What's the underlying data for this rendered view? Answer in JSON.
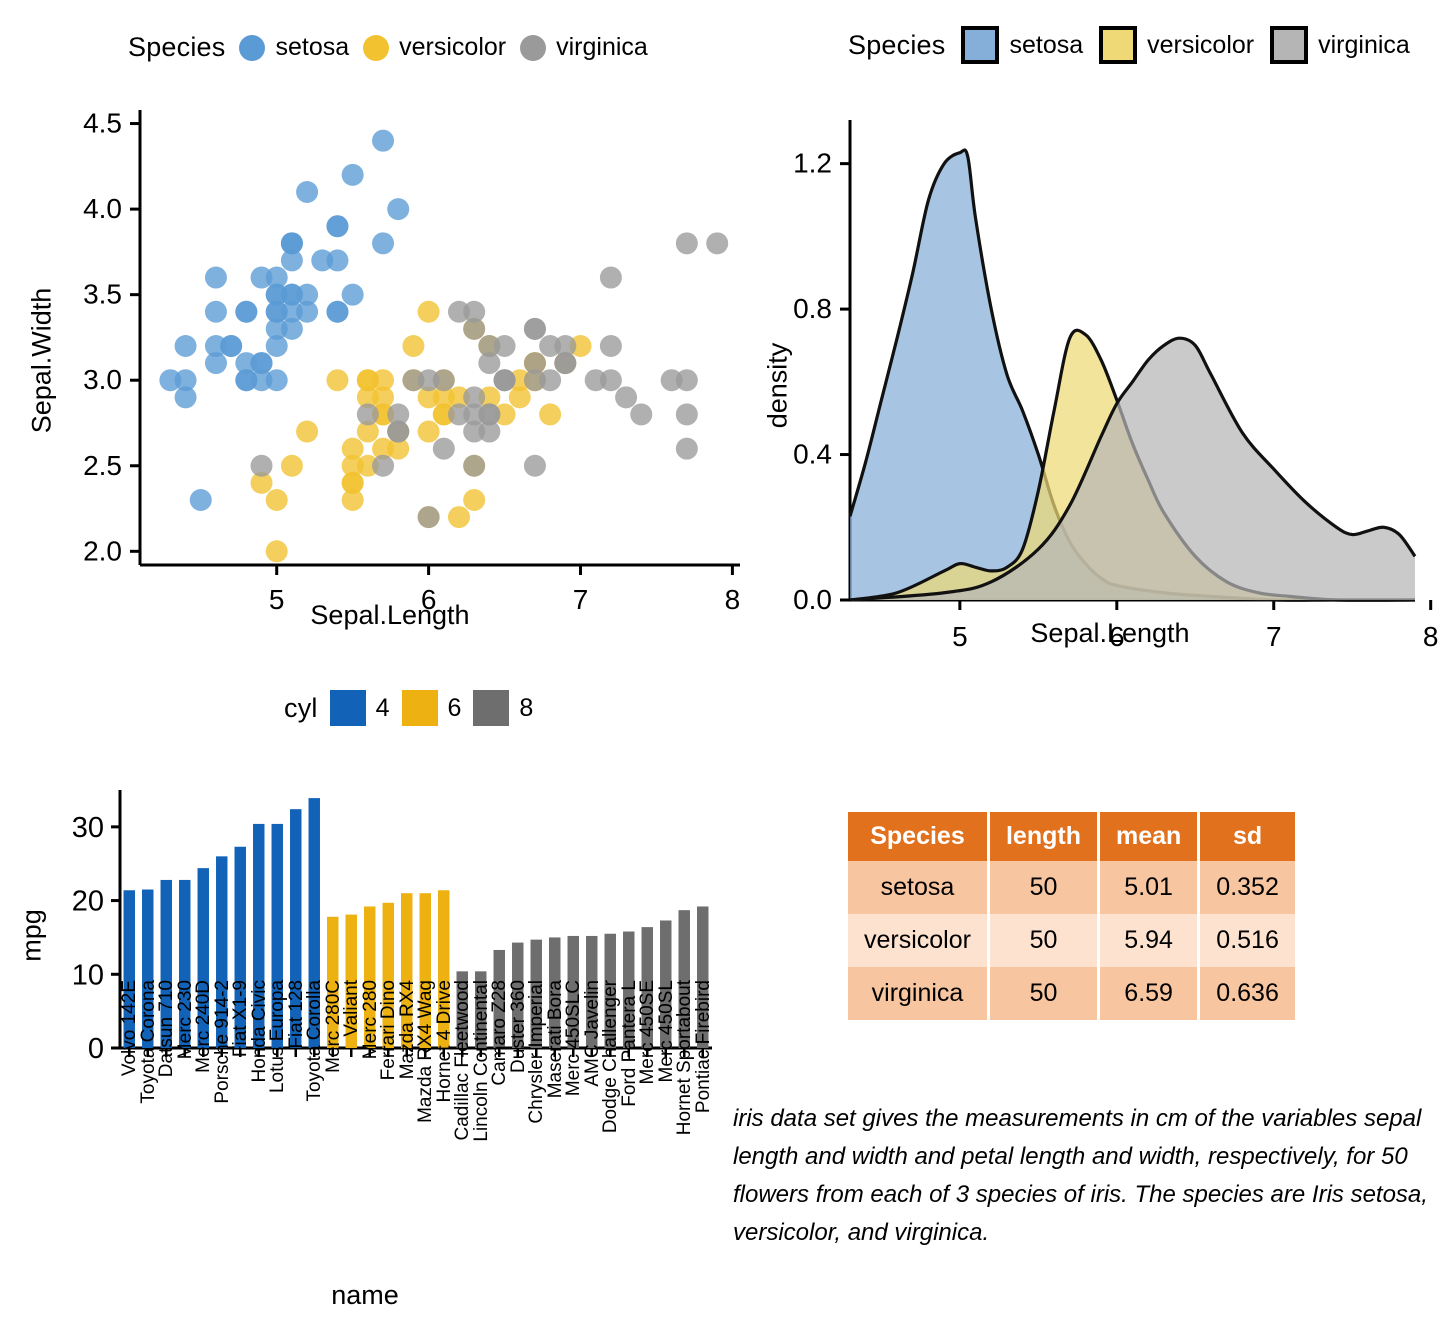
{
  "legends": {
    "species_points": {
      "title": "Species",
      "items": [
        {
          "label": "setosa",
          "color": "#5B9BD5",
          "marker": "circle"
        },
        {
          "label": "versicolor",
          "color": "#F2C230",
          "marker": "circle"
        },
        {
          "label": "virginica",
          "color": "#9A9A9A",
          "marker": "circle"
        }
      ]
    },
    "species_fill": {
      "title": "Species",
      "items": [
        {
          "label": "setosa",
          "color": "#85AFD8"
        },
        {
          "label": "versicolor",
          "color": "#EED976"
        },
        {
          "label": "virginica",
          "color": "#B5B5B5"
        }
      ]
    },
    "cyl": {
      "title": "cyl",
      "items": [
        {
          "label": "4",
          "color": "#1263B8"
        },
        {
          "label": "6",
          "color": "#EDB211"
        },
        {
          "label": "8",
          "color": "#6E6E6E"
        }
      ]
    }
  },
  "chart_data": [
    {
      "type": "scatter",
      "id": "iris-scatter",
      "title": "",
      "xlabel": "Sepal.Length",
      "ylabel": "Sepal.Width",
      "xlim": [
        4.1,
        8.05
      ],
      "ylim": [
        1.92,
        4.55
      ],
      "xticks": [
        5,
        6,
        7,
        8
      ],
      "yticks": [
        "2.0",
        "2.5",
        "3.0",
        "3.5",
        "4.0",
        "4.5"
      ],
      "grid": false,
      "legend_position": "top",
      "series": [
        {
          "name": "setosa",
          "color": "#5B9BD5",
          "points": [
            [
              5.1,
              3.5
            ],
            [
              4.9,
              3.0
            ],
            [
              4.7,
              3.2
            ],
            [
              4.6,
              3.1
            ],
            [
              5.0,
              3.6
            ],
            [
              5.4,
              3.9
            ],
            [
              4.6,
              3.4
            ],
            [
              5.0,
              3.4
            ],
            [
              4.4,
              2.9
            ],
            [
              4.9,
              3.1
            ],
            [
              5.4,
              3.7
            ],
            [
              4.8,
              3.4
            ],
            [
              4.8,
              3.0
            ],
            [
              4.3,
              3.0
            ],
            [
              5.8,
              4.0
            ],
            [
              5.7,
              4.4
            ],
            [
              5.4,
              3.9
            ],
            [
              5.1,
              3.5
            ],
            [
              5.7,
              3.8
            ],
            [
              5.1,
              3.8
            ],
            [
              5.4,
              3.4
            ],
            [
              5.1,
              3.7
            ],
            [
              4.6,
              3.6
            ],
            [
              5.1,
              3.3
            ],
            [
              4.8,
              3.4
            ],
            [
              5.0,
              3.0
            ],
            [
              5.0,
              3.4
            ],
            [
              5.2,
              3.5
            ],
            [
              5.2,
              3.4
            ],
            [
              4.7,
              3.2
            ],
            [
              4.8,
              3.1
            ],
            [
              5.4,
              3.4
            ],
            [
              5.2,
              4.1
            ],
            [
              5.5,
              4.2
            ],
            [
              4.9,
              3.1
            ],
            [
              5.0,
              3.2
            ],
            [
              5.5,
              3.5
            ],
            [
              4.9,
              3.6
            ],
            [
              4.4,
              3.0
            ],
            [
              5.1,
              3.4
            ],
            [
              5.0,
              3.5
            ],
            [
              4.5,
              2.3
            ],
            [
              4.4,
              3.2
            ],
            [
              5.0,
              3.5
            ],
            [
              5.1,
              3.8
            ],
            [
              4.8,
              3.0
            ],
            [
              5.1,
              3.8
            ],
            [
              4.6,
              3.2
            ],
            [
              5.3,
              3.7
            ],
            [
              5.0,
              3.3
            ]
          ]
        },
        {
          "name": "versicolor",
          "color": "#F2C230",
          "points": [
            [
              7.0,
              3.2
            ],
            [
              6.4,
              3.2
            ],
            [
              6.9,
              3.1
            ],
            [
              5.5,
              2.3
            ],
            [
              6.5,
              2.8
            ],
            [
              5.7,
              2.8
            ],
            [
              6.3,
              3.3
            ],
            [
              4.9,
              2.4
            ],
            [
              6.6,
              2.9
            ],
            [
              5.2,
              2.7
            ],
            [
              5.0,
              2.0
            ],
            [
              5.9,
              3.0
            ],
            [
              6.0,
              2.2
            ],
            [
              6.1,
              2.9
            ],
            [
              5.6,
              2.9
            ],
            [
              6.7,
              3.1
            ],
            [
              5.6,
              3.0
            ],
            [
              5.8,
              2.7
            ],
            [
              6.2,
              2.2
            ],
            [
              5.6,
              2.5
            ],
            [
              5.9,
              3.2
            ],
            [
              6.1,
              2.8
            ],
            [
              6.3,
              2.5
            ],
            [
              6.1,
              2.8
            ],
            [
              6.4,
              2.9
            ],
            [
              6.6,
              3.0
            ],
            [
              6.8,
              2.8
            ],
            [
              6.7,
              3.0
            ],
            [
              6.0,
              2.9
            ],
            [
              5.7,
              2.6
            ],
            [
              5.5,
              2.4
            ],
            [
              5.5,
              2.4
            ],
            [
              5.8,
              2.7
            ],
            [
              6.0,
              2.7
            ],
            [
              5.4,
              3.0
            ],
            [
              6.0,
              3.4
            ],
            [
              6.7,
              3.1
            ],
            [
              6.3,
              2.3
            ],
            [
              5.6,
              3.0
            ],
            [
              5.5,
              2.5
            ],
            [
              5.5,
              2.6
            ],
            [
              6.1,
              3.0
            ],
            [
              5.8,
              2.6
            ],
            [
              5.0,
              2.3
            ],
            [
              5.6,
              2.7
            ],
            [
              5.7,
              3.0
            ],
            [
              5.7,
              2.9
            ],
            [
              6.2,
              2.9
            ],
            [
              5.1,
              2.5
            ],
            [
              5.7,
              2.8
            ]
          ]
        },
        {
          "name": "virginica",
          "color": "#9A9A9A",
          "points": [
            [
              6.3,
              3.3
            ],
            [
              5.8,
              2.7
            ],
            [
              7.1,
              3.0
            ],
            [
              6.3,
              2.9
            ],
            [
              6.5,
              3.0
            ],
            [
              7.6,
              3.0
            ],
            [
              4.9,
              2.5
            ],
            [
              7.3,
              2.9
            ],
            [
              6.7,
              2.5
            ],
            [
              7.2,
              3.6
            ],
            [
              6.5,
              3.2
            ],
            [
              6.4,
              2.7
            ],
            [
              6.8,
              3.0
            ],
            [
              5.7,
              2.5
            ],
            [
              5.8,
              2.8
            ],
            [
              6.4,
              3.2
            ],
            [
              6.5,
              3.0
            ],
            [
              7.7,
              3.8
            ],
            [
              7.7,
              2.6
            ],
            [
              6.0,
              2.2
            ],
            [
              6.9,
              3.2
            ],
            [
              5.6,
              2.8
            ],
            [
              7.7,
              2.8
            ],
            [
              6.3,
              2.7
            ],
            [
              6.7,
              3.3
            ],
            [
              7.2,
              3.2
            ],
            [
              6.2,
              2.8
            ],
            [
              6.1,
              3.0
            ],
            [
              6.4,
              2.8
            ],
            [
              7.2,
              3.0
            ],
            [
              7.4,
              2.8
            ],
            [
              7.9,
              3.8
            ],
            [
              6.4,
              2.8
            ],
            [
              6.3,
              2.8
            ],
            [
              6.1,
              2.6
            ],
            [
              7.7,
              3.0
            ],
            [
              6.3,
              3.4
            ],
            [
              6.4,
              3.1
            ],
            [
              6.0,
              3.0
            ],
            [
              6.9,
              3.1
            ],
            [
              6.7,
              3.1
            ],
            [
              6.9,
              3.1
            ],
            [
              5.8,
              2.7
            ],
            [
              6.8,
              3.2
            ],
            [
              6.7,
              3.3
            ],
            [
              6.7,
              3.0
            ],
            [
              6.3,
              2.5
            ],
            [
              6.5,
              3.0
            ],
            [
              6.2,
              3.4
            ],
            [
              5.9,
              3.0
            ]
          ]
        }
      ]
    },
    {
      "type": "area",
      "id": "iris-density",
      "title": "",
      "xlabel": "Sepal.Length",
      "ylabel": "density",
      "xlim": [
        4.3,
        7.9
      ],
      "ylim": [
        0.0,
        1.32
      ],
      "xticks": [
        5,
        6,
        7,
        8
      ],
      "yticks": [
        "0.0",
        "0.4",
        "0.8",
        "1.2"
      ],
      "grid": false,
      "legend_position": "top",
      "series": [
        {
          "name": "setosa",
          "color": "#85AFD8",
          "x": [
            4.3,
            4.4,
            4.5,
            4.6,
            4.7,
            4.8,
            4.9,
            5.0,
            5.05,
            5.1,
            5.2,
            5.3,
            5.4,
            5.5,
            5.6,
            5.7,
            5.8,
            5.9,
            6.0,
            6.3,
            6.6,
            7.0,
            7.4,
            7.9
          ],
          "y": [
            0.23,
            0.38,
            0.55,
            0.72,
            0.9,
            1.1,
            1.2,
            1.23,
            1.22,
            1.05,
            0.8,
            0.62,
            0.52,
            0.4,
            0.26,
            0.16,
            0.1,
            0.06,
            0.04,
            0.02,
            0.01,
            0.0,
            0.0,
            0.0
          ]
        },
        {
          "name": "versicolor",
          "color": "#EED976",
          "x": [
            4.3,
            4.6,
            4.9,
            5.0,
            5.1,
            5.2,
            5.3,
            5.4,
            5.5,
            5.6,
            5.7,
            5.8,
            5.9,
            6.0,
            6.1,
            6.2,
            6.3,
            6.5,
            6.7,
            6.9,
            7.1,
            7.4,
            7.9
          ],
          "y": [
            0.0,
            0.02,
            0.08,
            0.1,
            0.09,
            0.08,
            0.09,
            0.14,
            0.3,
            0.52,
            0.72,
            0.73,
            0.66,
            0.55,
            0.43,
            0.33,
            0.24,
            0.12,
            0.05,
            0.02,
            0.01,
            0.0,
            0.0
          ]
        },
        {
          "name": "virginica",
          "color": "#B5B5B5",
          "x": [
            4.3,
            4.9,
            5.2,
            5.5,
            5.7,
            5.9,
            6.0,
            6.1,
            6.2,
            6.3,
            6.4,
            6.5,
            6.6,
            6.8,
            7.0,
            7.2,
            7.4,
            7.5,
            7.6,
            7.7,
            7.8,
            7.9
          ],
          "y": [
            0.0,
            0.02,
            0.05,
            0.14,
            0.26,
            0.45,
            0.54,
            0.6,
            0.66,
            0.7,
            0.72,
            0.7,
            0.62,
            0.46,
            0.36,
            0.27,
            0.2,
            0.18,
            0.19,
            0.2,
            0.18,
            0.12
          ]
        }
      ]
    },
    {
      "type": "bar",
      "id": "mtcars-mpg",
      "title": "",
      "xlabel": "name",
      "ylabel": "mpg",
      "ylim": [
        0,
        35
      ],
      "yticks": [
        0,
        10,
        20,
        30
      ],
      "grid": false,
      "legend_position": "top",
      "group_field": "cyl",
      "categories": [
        "Volvo 142E",
        "Toyota Corona",
        "Datsun 710",
        "Merc 230",
        "Merc 240D",
        "Porsche 914-2",
        "Fiat X1-9",
        "Honda Civic",
        "Lotus Europa",
        "Fiat 128",
        "Toyota Corolla",
        "Merc 280C",
        "Valiant",
        "Merc 280",
        "Ferrari Dino",
        "Mazda RX4",
        "Mazda RX4 Wag",
        "Hornet 4 Drive",
        "Cadillac Fleetwood",
        "Lincoln Continental",
        "Camaro Z28",
        "Duster 360",
        "Chrysler Imperial",
        "Maserati Bora",
        "Merc 450SLC",
        "AMC Javelin",
        "Dodge Challenger",
        "Ford Pantera L",
        "Merc 450SE",
        "Merc 450SL",
        "Hornet Sportabout",
        "Pontiac Firebird"
      ],
      "values": [
        21.4,
        21.5,
        22.8,
        22.8,
        24.4,
        26.0,
        27.3,
        30.4,
        30.4,
        32.4,
        33.9,
        17.8,
        18.1,
        19.2,
        19.7,
        21.0,
        21.0,
        21.4,
        10.4,
        10.4,
        13.3,
        14.3,
        14.7,
        15.0,
        15.2,
        15.2,
        15.5,
        15.8,
        16.4,
        17.3,
        18.7,
        19.2
      ],
      "groups": [
        4,
        4,
        4,
        4,
        4,
        4,
        4,
        4,
        4,
        4,
        4,
        6,
        6,
        6,
        6,
        6,
        6,
        6,
        8,
        8,
        8,
        8,
        8,
        8,
        8,
        8,
        8,
        8,
        8,
        8,
        8,
        8
      ]
    },
    {
      "type": "table",
      "id": "iris-summary",
      "columns": [
        "Species",
        "length",
        "mean",
        "sd"
      ],
      "rows": [
        [
          "setosa",
          "50",
          "5.01",
          "0.352"
        ],
        [
          "versicolor",
          "50",
          "5.94",
          "0.516"
        ],
        [
          "virginica",
          "50",
          "6.59",
          "0.636"
        ]
      ]
    }
  ],
  "caption": {
    "text": "iris data set gives the measurements in cm of the variables sepal length and width and petal length and width, respectively, for 50 flowers from each of 3 species of iris. The species are Iris setosa, versicolor, and virginica."
  },
  "colors": {
    "header_bg": "#E2711D",
    "row_odd": "#F7C59F",
    "row_even": "#FDE3CF",
    "axis": "#000000"
  }
}
